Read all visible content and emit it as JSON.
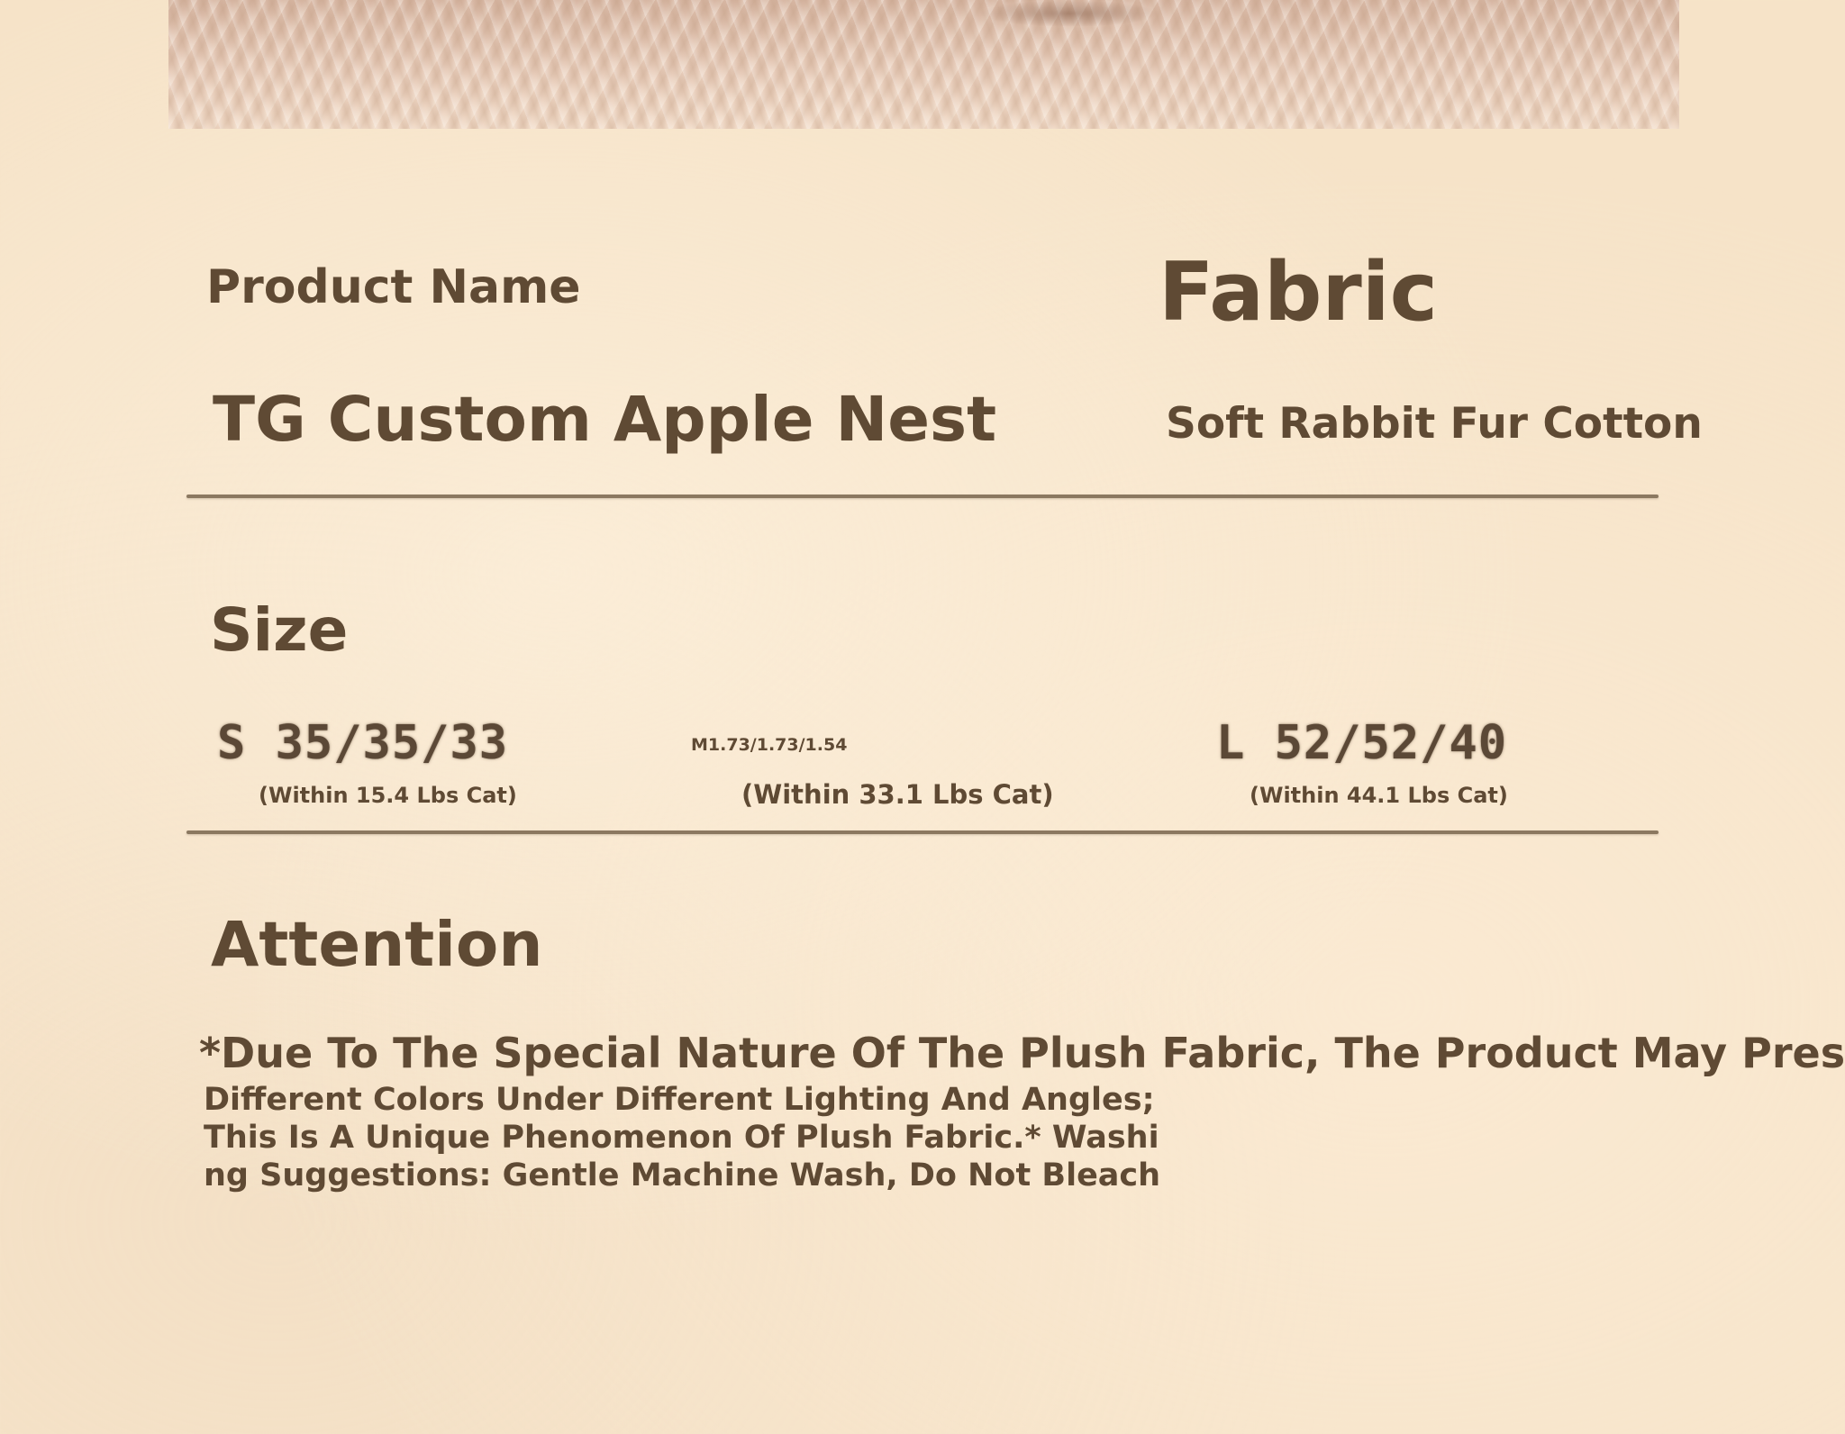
{
  "product_name": {
    "label": "Product Name",
    "value": "TG Custom Apple Nest"
  },
  "fabric": {
    "label": "Fabric",
    "value": "Soft Rabbit Fur Cotton"
  },
  "size": {
    "label": "Size",
    "small": {
      "dims": "S 35/35/33",
      "note": "(Within 15.4 Lbs Cat)"
    },
    "medium": {
      "dims": "M1.73/1.73/1.54",
      "note": "(Within 33.1 Lbs Cat)"
    },
    "large": {
      "dims": "L 52/52/40",
      "note": "(Within 44.1 Lbs Cat)"
    }
  },
  "attention": {
    "label": "Attention",
    "headline": "*Due To The Special Nature Of The Plush Fabric, The Product May Present",
    "lines": [
      "Different Colors Under Different Lighting And Angles;",
      "This Is A Unique Phenomenon Of Plush Fabric.* Washi",
      "ng Suggestions: Gentle Machine Wash, Do Not Bleach"
    ]
  }
}
